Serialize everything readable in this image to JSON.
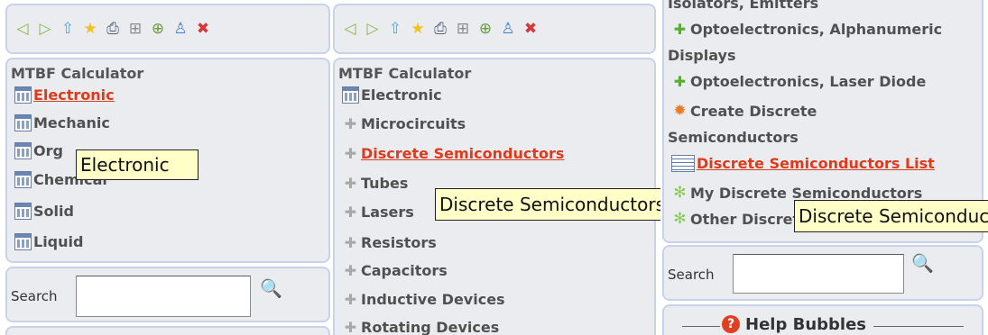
{
  "panel1": {
    "toolbar": [
      "back-arrow",
      "forward-arrow",
      "home-up",
      "favorite-star",
      "print",
      "network",
      "network-add",
      "user",
      "close"
    ],
    "title": "MTBF Calculator",
    "items": [
      {
        "label": "Electronic",
        "active": true
      },
      {
        "label": "Mechanic"
      },
      {
        "label": "Org"
      },
      {
        "label": "Chemical"
      },
      {
        "label": "Solid"
      },
      {
        "label": "Liquid"
      }
    ],
    "tooltip": "Electronic",
    "search_label": "Search"
  },
  "panel2": {
    "title": "MTBF Calculator",
    "items": [
      {
        "label": "Electronic"
      },
      {
        "label": "Microcircuits"
      },
      {
        "label": "Discrete Semiconductors",
        "active": true
      },
      {
        "label": "Tubes"
      },
      {
        "label": "Lasers"
      },
      {
        "label": "Resistors"
      },
      {
        "label": "Capacitors"
      },
      {
        "label": "Inductive Devices"
      },
      {
        "label": "Rotating Devices"
      }
    ],
    "tooltip": "Discrete Semiconductors"
  },
  "panel3": {
    "items": [
      {
        "label": "Isolators, Emitters"
      },
      {
        "label": "Optoelectronics, Alphanumeric"
      },
      {
        "label": "Displays"
      },
      {
        "label": "Optoelectronics, Laser Diode"
      },
      {
        "label": "Create Discrete"
      },
      {
        "label": "Semiconductors"
      },
      {
        "label": "Discrete Semiconductors List",
        "active": true
      },
      {
        "label": "My Discrete Semiconductors"
      },
      {
        "label": "Other Discrete Semiconductors"
      }
    ],
    "tooltip": "Discrete Semiconductors",
    "search_label": "Search",
    "help_title": "Help Bubbles"
  },
  "colors": {
    "link": "#e03a1a",
    "panel_bg": "#eaecf0",
    "panel_border": "#c8d2ea",
    "tooltip_bg": "#ffffc8"
  }
}
